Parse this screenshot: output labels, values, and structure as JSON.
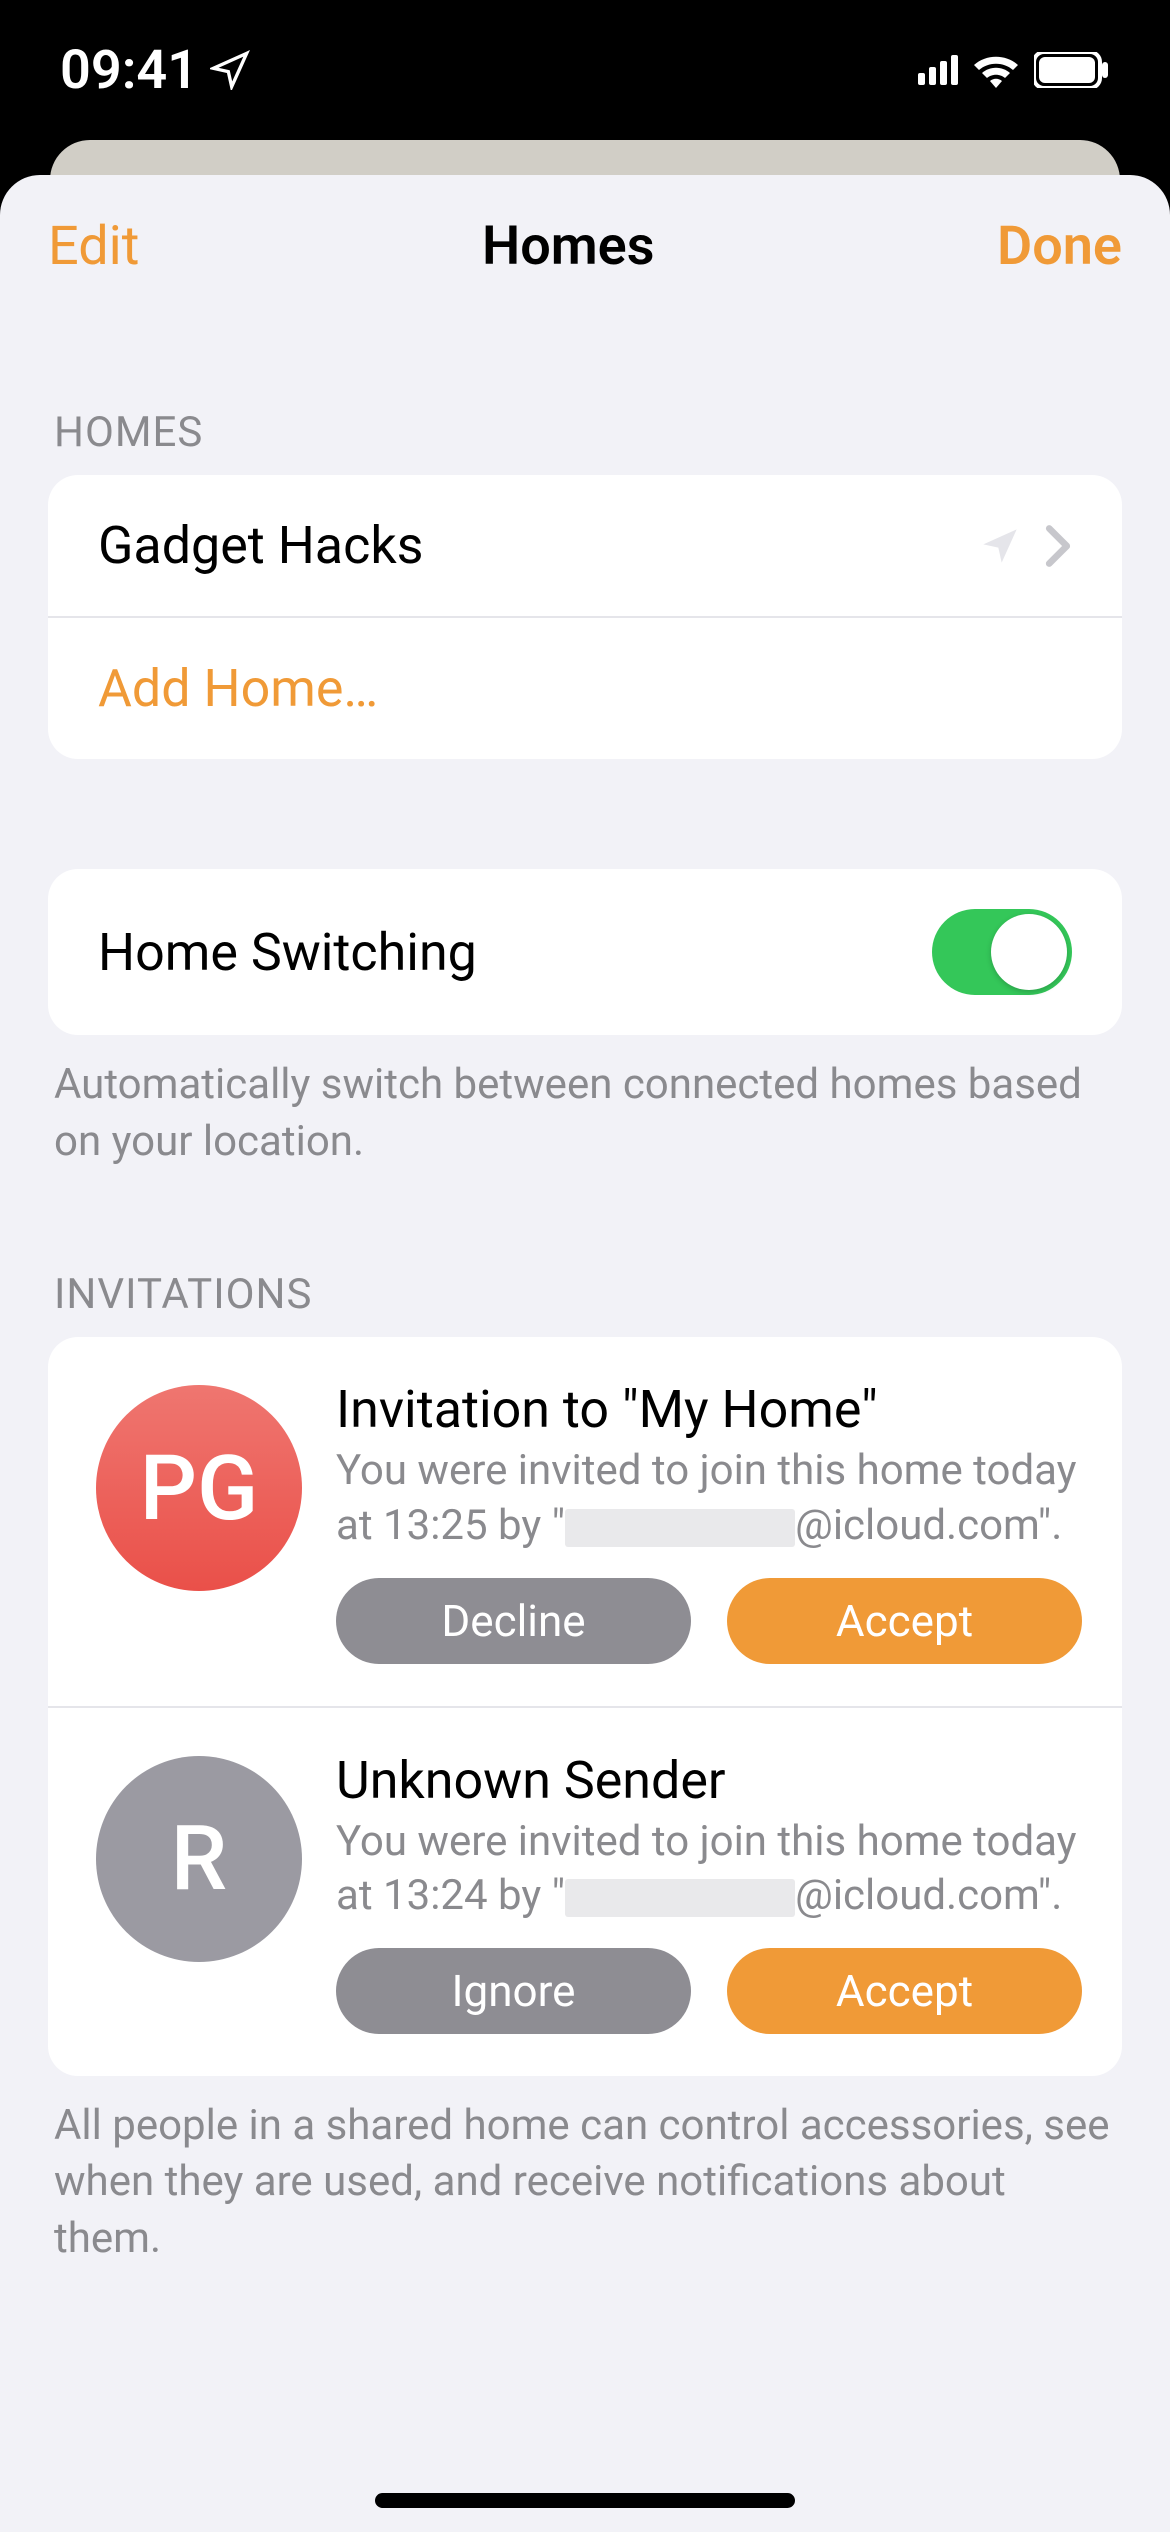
{
  "statusBar": {
    "time": "09:41"
  },
  "nav": {
    "left": "Edit",
    "title": "Homes",
    "right": "Done"
  },
  "sections": {
    "homes": {
      "header": "Homes",
      "items": [
        {
          "label": "Gadget Hacks"
        }
      ],
      "addLabel": "Add Home…"
    },
    "switching": {
      "label": "Home Switching",
      "footer": "Automatically switch between connected homes based on your location."
    },
    "invitations": {
      "header": "Invitations",
      "items": [
        {
          "initials": "PG",
          "title": "Invitation to \"My Home\"",
          "descPrefix": "You were invited to join this home today at 13:25 by \"",
          "descSuffix": "@icloud.com\".",
          "declineLabel": "Decline",
          "acceptLabel": "Accept"
        },
        {
          "initials": "R",
          "title": "Unknown Sender",
          "descPrefix": "You were invited to join this home today at 13:24 by \"",
          "descSuffix": "@icloud.com\".",
          "declineLabel": "Ignore",
          "acceptLabel": "Accept"
        }
      ],
      "footer": "All people in a shared home can control accessories, see when they are used, and receive notifications about them."
    }
  }
}
